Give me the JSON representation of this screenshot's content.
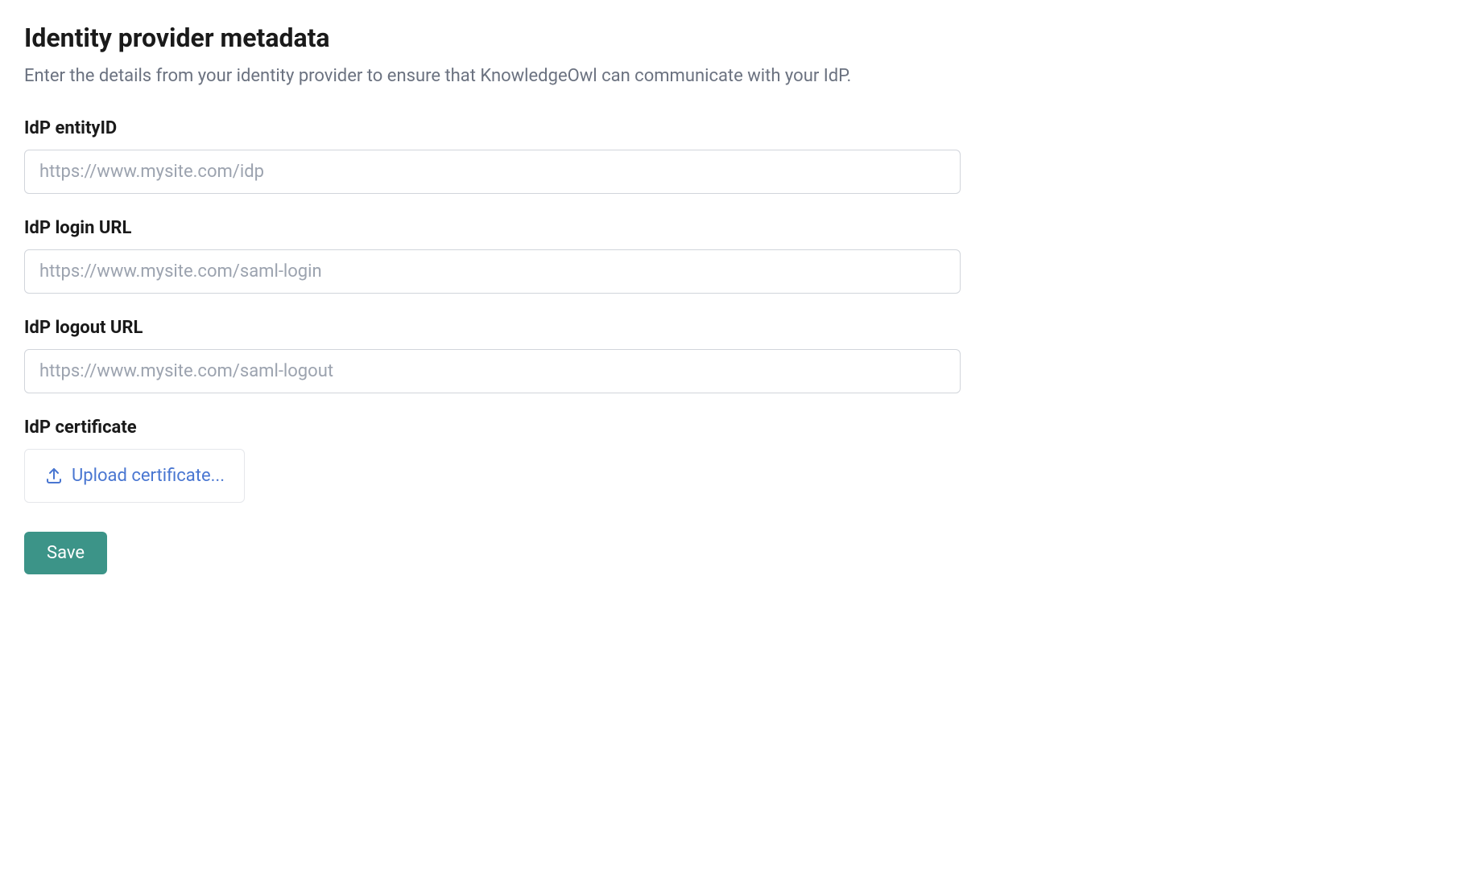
{
  "section": {
    "title": "Identity provider metadata",
    "description": "Enter the details from your identity provider to ensure that KnowledgeOwl can communicate with your IdP."
  },
  "fields": {
    "entity_id": {
      "label": "IdP entityID",
      "placeholder": "https://www.mysite.com/idp",
      "value": ""
    },
    "login_url": {
      "label": "IdP login URL",
      "placeholder": "https://www.mysite.com/saml-login",
      "value": ""
    },
    "logout_url": {
      "label": "IdP logout URL",
      "placeholder": "https://www.mysite.com/saml-logout",
      "value": ""
    },
    "certificate": {
      "label": "IdP certificate",
      "upload_label": "Upload certificate..."
    }
  },
  "buttons": {
    "save_label": "Save"
  }
}
